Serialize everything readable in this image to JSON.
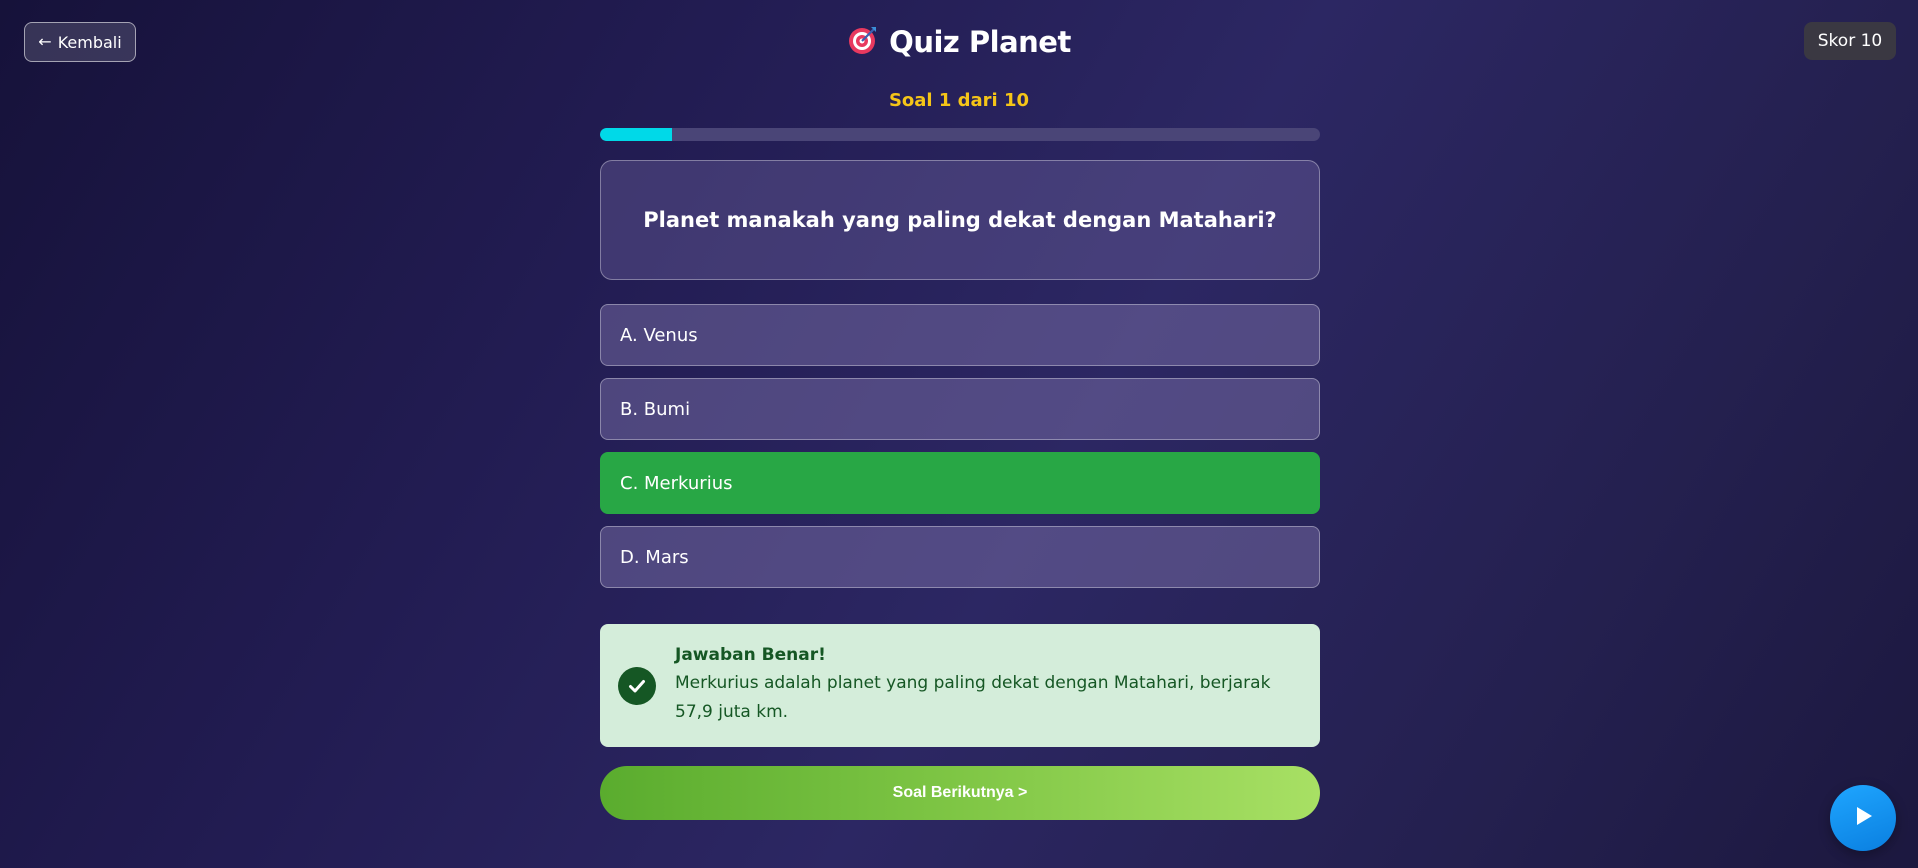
{
  "header": {
    "back_label": "Kembali",
    "title": "Quiz Planet",
    "score_label": "Skor 10"
  },
  "quiz": {
    "counter": "Soal 1 dari 10",
    "progress_fraction": 0.1,
    "question": "Planet manakah yang paling dekat dengan Matahari?",
    "options": [
      {
        "label": "A. Venus",
        "state": "default"
      },
      {
        "label": "B. Bumi",
        "state": "default"
      },
      {
        "label": "C. Merkurius",
        "state": "correct"
      },
      {
        "label": "D. Mars",
        "state": "default"
      }
    ]
  },
  "feedback": {
    "title": "Jawaban Benar!",
    "body": "Merkurius adalah planet yang paling dekat dengan Matahari, berjarak 57,9 juta km."
  },
  "next_button_label": "Soal Berikutnya >",
  "colors": {
    "accent_progress": "#00d9e8",
    "counter_text": "#f5c518",
    "correct_option": "#28a745",
    "feedback_bg": "#d4edda",
    "feedback_text": "#155724"
  },
  "icons": {
    "back": "arrow-left-icon",
    "title": "target-icon",
    "feedback": "check-circle-icon",
    "fab": "play-icon"
  }
}
